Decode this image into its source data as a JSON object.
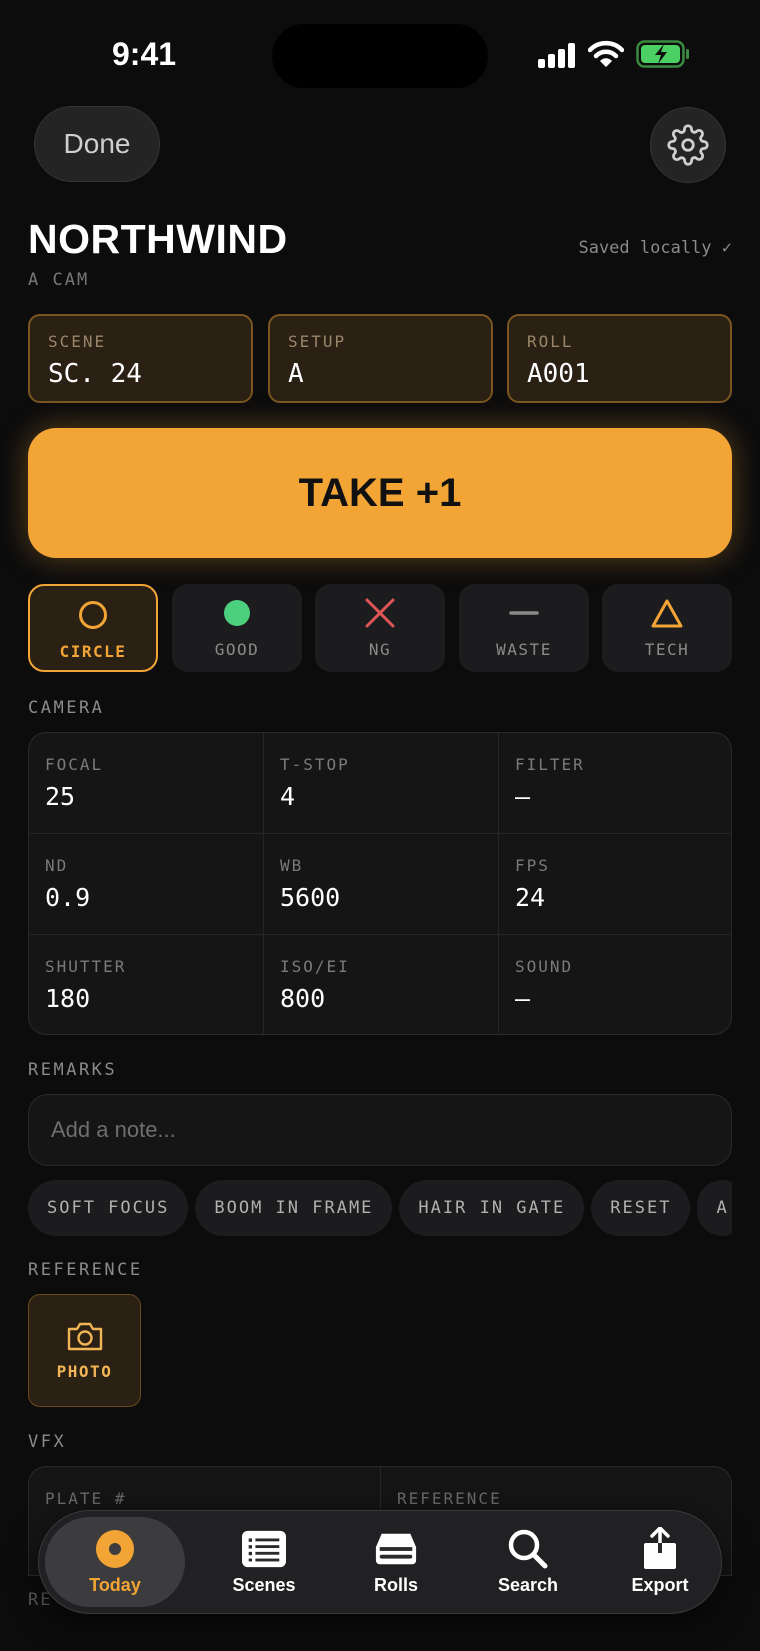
{
  "status": {
    "time": "9:41"
  },
  "header": {
    "done_label": "Done",
    "title": "NORTHWIND",
    "subtitle": "A CAM",
    "saved": "Saved locally ✓"
  },
  "slate": [
    {
      "label": "SCENE",
      "value": "SC. 24"
    },
    {
      "label": "SETUP",
      "value": "A"
    },
    {
      "label": "ROLL",
      "value": "A001"
    }
  ],
  "take_label": "TAKE +1",
  "ratings": [
    {
      "label": "CIRCLE",
      "icon": "circle-icon",
      "active": true
    },
    {
      "label": "GOOD",
      "icon": "dot-icon",
      "active": false
    },
    {
      "label": "NG",
      "icon": "cross-icon",
      "active": false
    },
    {
      "label": "WASTE",
      "icon": "dash-icon",
      "active": false
    },
    {
      "label": "TECH",
      "icon": "triangle-icon",
      "active": false
    }
  ],
  "camera": {
    "section": "CAMERA",
    "fields": [
      {
        "label": "FOCAL",
        "value": "25"
      },
      {
        "label": "T-STOP",
        "value": "4"
      },
      {
        "label": "FILTER",
        "value": "—"
      },
      {
        "label": "ND",
        "value": "0.9"
      },
      {
        "label": "WB",
        "value": "5600"
      },
      {
        "label": "FPS",
        "value": "24"
      },
      {
        "label": "SHUTTER",
        "value": "180"
      },
      {
        "label": "ISO/EI",
        "value": "800"
      },
      {
        "label": "SOUND",
        "value": "—"
      }
    ]
  },
  "remarks": {
    "section": "REMARKS",
    "placeholder": "Add a note...",
    "chips": [
      "SOFT FOCUS",
      "BOOM IN FRAME",
      "HAIR IN GATE",
      "RESET",
      "A"
    ]
  },
  "reference": {
    "section": "REFERENCE",
    "photo_label": "PHOTO"
  },
  "vfx": {
    "section": "VFX",
    "fields": [
      {
        "label": "PLATE #"
      },
      {
        "label": "REFERENCE"
      }
    ]
  },
  "cut_label": "RE",
  "tabs": [
    {
      "label": "Today",
      "icon": "today-icon",
      "active": true
    },
    {
      "label": "Scenes",
      "icon": "list-icon",
      "active": false
    },
    {
      "label": "Rolls",
      "icon": "roll-icon",
      "active": false
    },
    {
      "label": "Search",
      "icon": "search-icon",
      "active": false
    },
    {
      "label": "Export",
      "icon": "share-icon",
      "active": false
    }
  ],
  "colors": {
    "accent": "#f2a535",
    "good": "#4cd07d",
    "ng": "#e05555",
    "background": "#0c0c0d"
  }
}
